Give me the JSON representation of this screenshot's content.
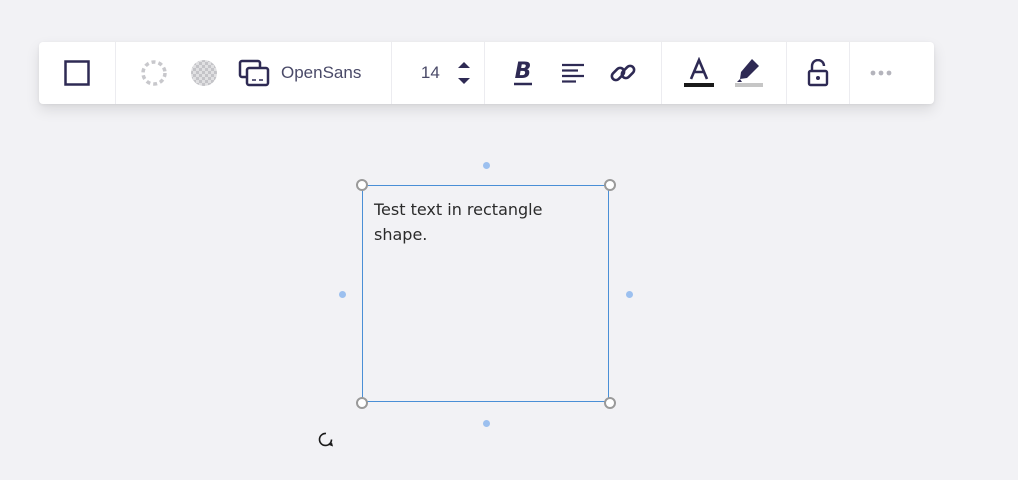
{
  "toolbar": {
    "font_name": "OpenSans",
    "font_size": "14",
    "icons": {
      "shape": "square-outline-icon",
      "border": "dashed-circle-border-icon",
      "fill": "transparent-fill-icon",
      "layer": "stacked-windows-icon",
      "step_up": "chevron-up-icon",
      "step_down": "chevron-down-icon",
      "bold": "bold-italic-icon",
      "align": "align-left-icon",
      "link": "link-icon",
      "text_color": "text-color-icon",
      "highlight": "highlighter-pen-icon",
      "lock": "unlock-icon",
      "more": "more-dots-icon"
    },
    "colors": {
      "icon": "#2e2a54",
      "disabled": "#c8c8cc",
      "text_color_bar": "#1a1a1a",
      "highlight_bar": "#c6c6c6"
    }
  },
  "canvas": {
    "shape_text": "Test text in rectangle shape.",
    "selection_color": "#4a8fd6",
    "rotate_icon": "rotate-icon"
  }
}
